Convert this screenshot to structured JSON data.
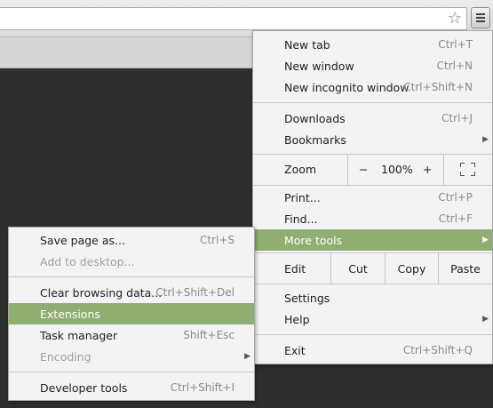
{
  "main_menu": {
    "new_tab": {
      "label": "New tab",
      "accel": "Ctrl+T"
    },
    "new_window": {
      "label": "New window",
      "accel": "Ctrl+N"
    },
    "new_incognito": {
      "label": "New incognito window",
      "accel": "Ctrl+Shift+N"
    },
    "downloads": {
      "label": "Downloads",
      "accel": "Ctrl+J"
    },
    "bookmarks": {
      "label": "Bookmarks"
    },
    "zoom": {
      "label": "Zoom",
      "minus": "−",
      "value": "100%",
      "plus": "+"
    },
    "print": {
      "label": "Print...",
      "accel": "Ctrl+P"
    },
    "find": {
      "label": "Find...",
      "accel": "Ctrl+F"
    },
    "more_tools": {
      "label": "More tools"
    },
    "edit": {
      "label": "Edit",
      "cut": "Cut",
      "copy": "Copy",
      "paste": "Paste"
    },
    "settings": {
      "label": "Settings"
    },
    "help": {
      "label": "Help"
    },
    "exit": {
      "label": "Exit",
      "accel": "Ctrl+Shift+Q"
    }
  },
  "sub_menu": {
    "save_page": {
      "label": "Save page as...",
      "accel": "Ctrl+S"
    },
    "add_desktop": {
      "label": "Add to desktop..."
    },
    "clear_data": {
      "label": "Clear browsing data...",
      "accel": "Ctrl+Shift+Del"
    },
    "extensions": {
      "label": "Extensions"
    },
    "task_manager": {
      "label": "Task manager",
      "accel": "Shift+Esc"
    },
    "encoding": {
      "label": "Encoding"
    },
    "dev_tools": {
      "label": "Developer tools",
      "accel": "Ctrl+Shift+I"
    }
  },
  "icons": {
    "star": "star-icon",
    "menu": "hamburger-menu-icon",
    "submenu_arrow": "chevron-right-icon",
    "fullscreen": "fullscreen-icon"
  },
  "colors": {
    "highlight": "#90ad72",
    "menu_bg": "#f3f3f3",
    "page_bg": "#2e2e2e"
  }
}
